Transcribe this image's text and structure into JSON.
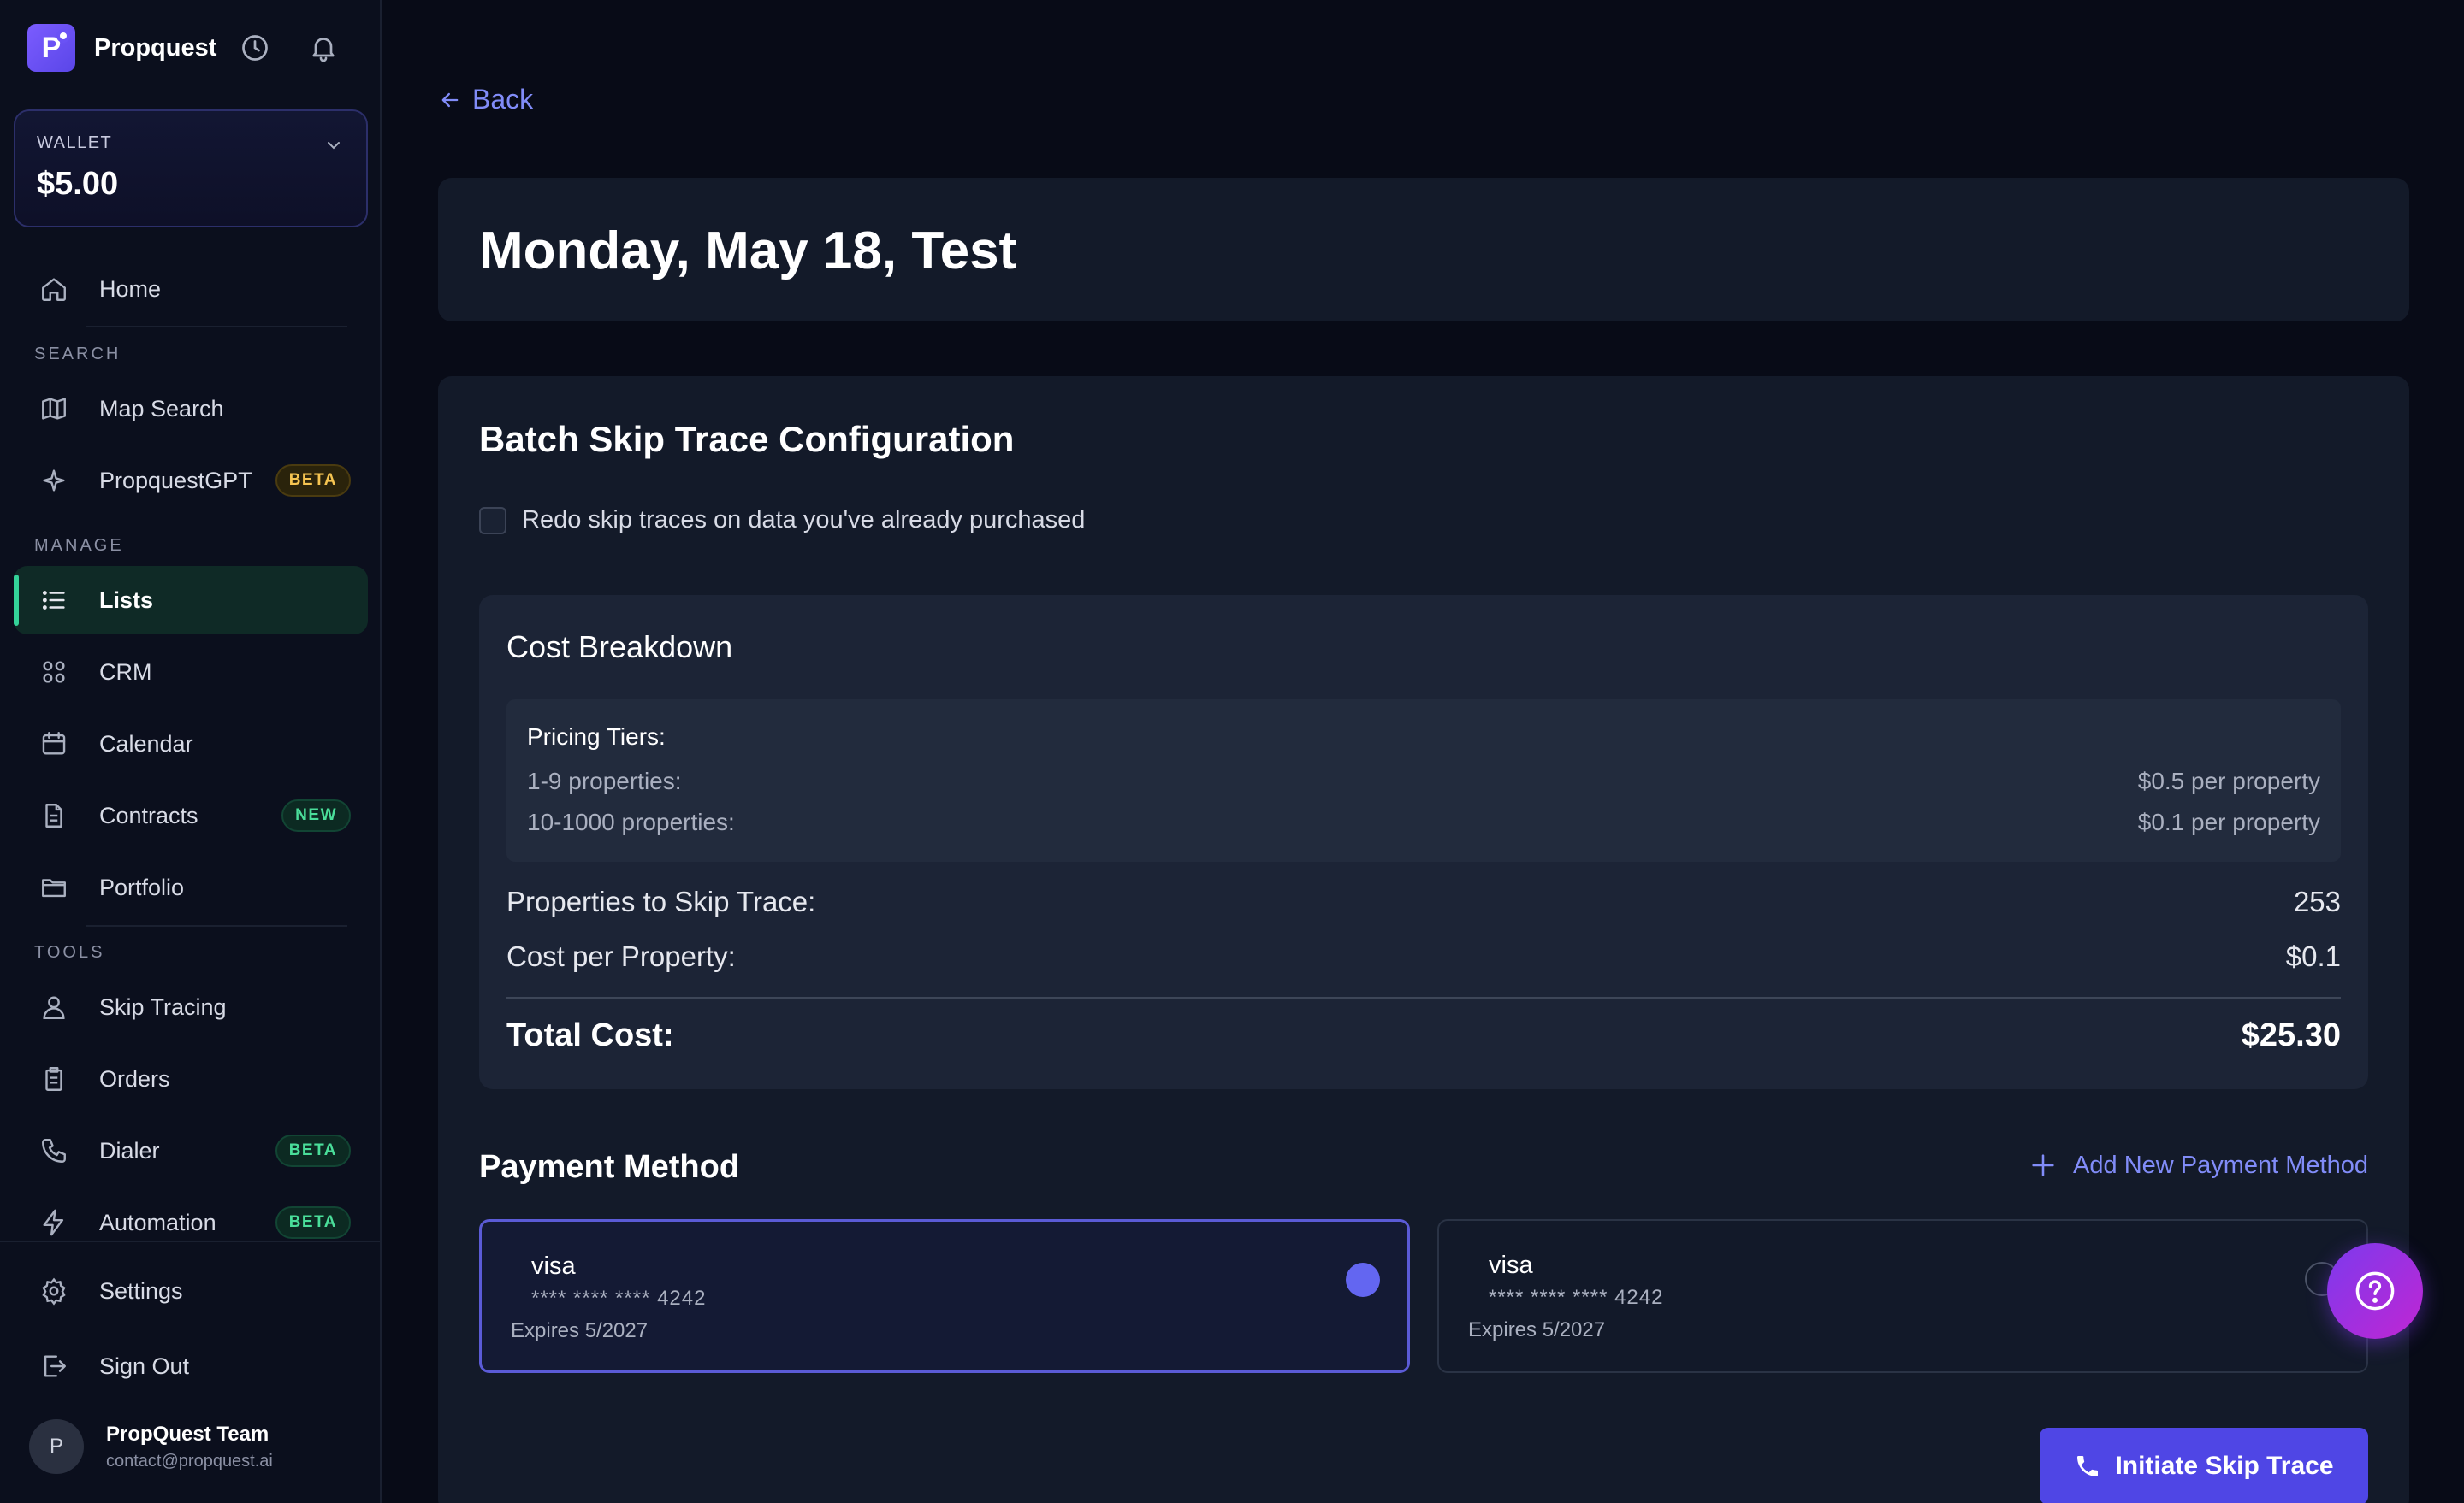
{
  "app": {
    "name": "Propquest",
    "logo_letter": "P"
  },
  "wallet": {
    "label": "WALLET",
    "amount": "$5.00"
  },
  "sidebar": {
    "home": "Home",
    "sections": {
      "search": "SEARCH",
      "manage": "MANAGE",
      "tools": "TOOLS"
    },
    "items": {
      "map_search": "Map Search",
      "propquest_gpt": "PropquestGPT",
      "lists": "Lists",
      "crm": "CRM",
      "calendar": "Calendar",
      "contracts": "Contracts",
      "portfolio": "Portfolio",
      "skip_tracing": "Skip Tracing",
      "orders": "Orders",
      "dialer": "Dialer",
      "automation": "Automation",
      "settings": "Settings",
      "sign_out": "Sign Out"
    },
    "badges": {
      "beta": "BETA",
      "new": "NEW"
    },
    "active_item": "Lists"
  },
  "profile": {
    "initial": "P",
    "name": "PropQuest Team",
    "email": "contact@propquest.ai"
  },
  "main": {
    "back_label": "Back",
    "page_title": "Monday, May 18, Test",
    "config_title": "Batch Skip Trace Configuration",
    "redo_checkbox": {
      "label": "Redo skip traces on data you've already purchased",
      "checked": false
    },
    "cost": {
      "title": "Cost Breakdown",
      "tiers_title": "Pricing Tiers:",
      "tiers": [
        {
          "range": "1-9 properties:",
          "price": "$0.5 per property"
        },
        {
          "range": "10-1000 properties:",
          "price": "$0.1 per property"
        }
      ],
      "properties_label": "Properties to Skip Trace:",
      "properties_value": "253",
      "cpp_label": "Cost per Property:",
      "cpp_value": "$0.1",
      "total_label": "Total Cost:",
      "total_value": "$25.30"
    },
    "payment": {
      "title": "Payment Method",
      "add_label": "Add New Payment Method",
      "cards": [
        {
          "brand": "visa",
          "number": "**** **** **** 4242",
          "expires": "Expires 5/2027",
          "selected": true
        },
        {
          "brand": "visa",
          "number": "**** **** **** 4242",
          "expires": "Expires 5/2027",
          "selected": false
        }
      ]
    },
    "cta_label": "Initiate Skip Trace"
  },
  "colors": {
    "accent": "#4f46e5",
    "link": "#818cf8",
    "active_green": "#34d399",
    "background": "#080b17"
  }
}
